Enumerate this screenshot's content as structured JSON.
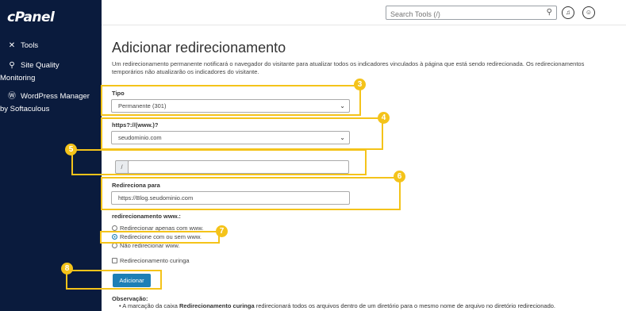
{
  "sidebar": {
    "logo": "cPanel",
    "items": [
      {
        "label": "Tools"
      },
      {
        "label": "Site Quality",
        "label2": "Monitoring"
      },
      {
        "label": "WordPress Manager",
        "label2": "by Softaculous"
      }
    ]
  },
  "header": {
    "search_placeholder": "Search Tools (/)"
  },
  "main": {
    "title": "Adicionar redirecionamento",
    "description": "Um redirecionamento permanente notificará o navegador do visitante para atualizar todos os indicadores vinculados à página que está sendo redirecionada. Os redirecionamentos temporários não atualizarão os indicadores do visitante.",
    "tipo_label": "Tipo",
    "tipo_value": "Permanente (301)",
    "https_label": "https?://(www.)?",
    "https_value": "seudominio.com",
    "path_prefix": "/",
    "path_value": "",
    "redir_label": "Redireciona para",
    "redir_value": "https://Blog.seudominio.com",
    "www_label": "redirecionamento www.:",
    "radios": [
      {
        "label": "Redirecionar apenas com www.",
        "selected": false
      },
      {
        "label": "Redirecione com ou sem www.",
        "selected": true
      },
      {
        "label": "Não redirecionar www.",
        "selected": false
      }
    ],
    "wildcard_label": "Redirecionamento curinga",
    "add_button": "Adicionar",
    "obs_title": "Observação:",
    "obs_pre": "A marcação da caixa ",
    "obs_bold": "Redirecionamento curinga",
    "obs_post": " redirecionará todos os arquivos dentro de um diretório para o mesmo nome de arquivo no diretório redirecionado."
  },
  "annotations": {
    "badges": [
      "3",
      "4",
      "5",
      "6",
      "7",
      "8"
    ],
    "color": "#f4c31a"
  }
}
